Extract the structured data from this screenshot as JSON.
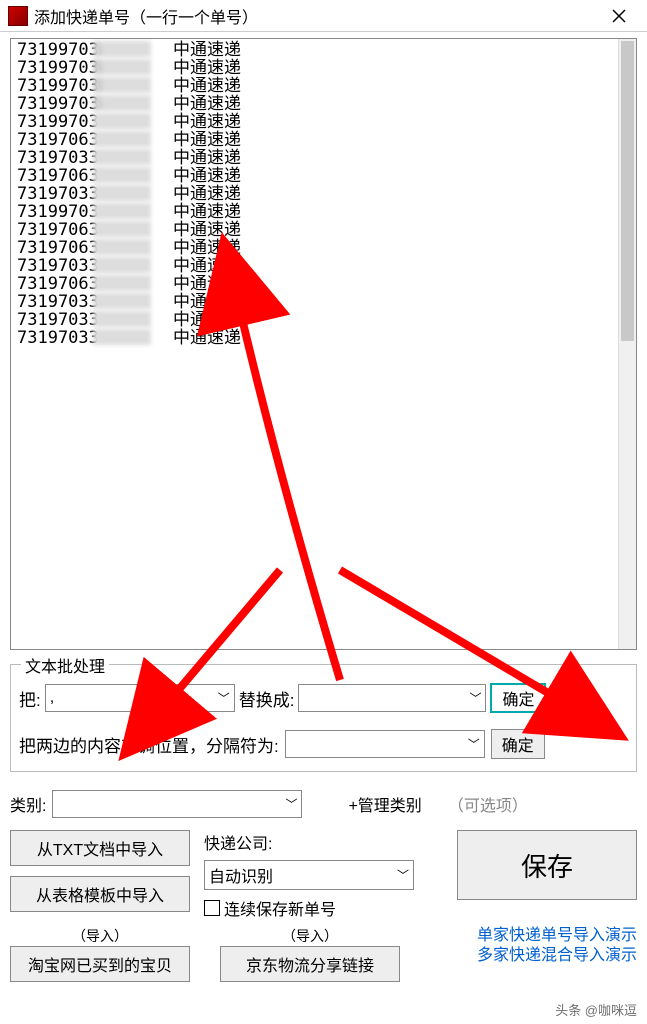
{
  "titlebar": {
    "title": "添加快递单号（一行一个单号）"
  },
  "tracking_list": {
    "company": "中通速递",
    "numbers": [
      "7319970",
      "7319970",
      "7319970",
      "7319970",
      "7319970",
      "7319706",
      "7319703",
      "7319706",
      "7319703",
      "7319970",
      "7319706",
      "7319706",
      "7319703",
      "7319706",
      "7319703",
      "7319703",
      "7319703"
    ],
    "visible_suffix": [
      "5",
      "8",
      "8",
      "5",
      "",
      "",
      "",
      "",
      "",
      "",
      "",
      "",
      "",
      "",
      "",
      "",
      ""
    ]
  },
  "batch": {
    "group_title": "文本批处理",
    "replace_from_label": "把:",
    "replace_from_value": ",",
    "replace_to_label": "替换成:",
    "replace_to_value": "",
    "confirm_label": "确定",
    "swap_label": "把两边的内容对调位置，分隔符为:",
    "swap_value": "",
    "confirm2_label": "确定"
  },
  "category": {
    "label": "类别:",
    "value": "",
    "manage_link": "+管理类别",
    "optional_note": "（可选项）"
  },
  "imports": {
    "from_txt": "从TXT文档中导入",
    "from_table": "从表格模板中导入",
    "courier_label": "快递公司:",
    "courier_value": "自动识别",
    "continuous_save": "连续保存新单号",
    "save_label": "保存",
    "import_hint": "（导入）",
    "taobao": "淘宝网已买到的宝贝",
    "jd": "京东物流分享链接",
    "demo1": "单家快递单号导入演示",
    "demo2": "多家快递混合导入演示"
  },
  "watermark": "头条 @咖咪逗"
}
